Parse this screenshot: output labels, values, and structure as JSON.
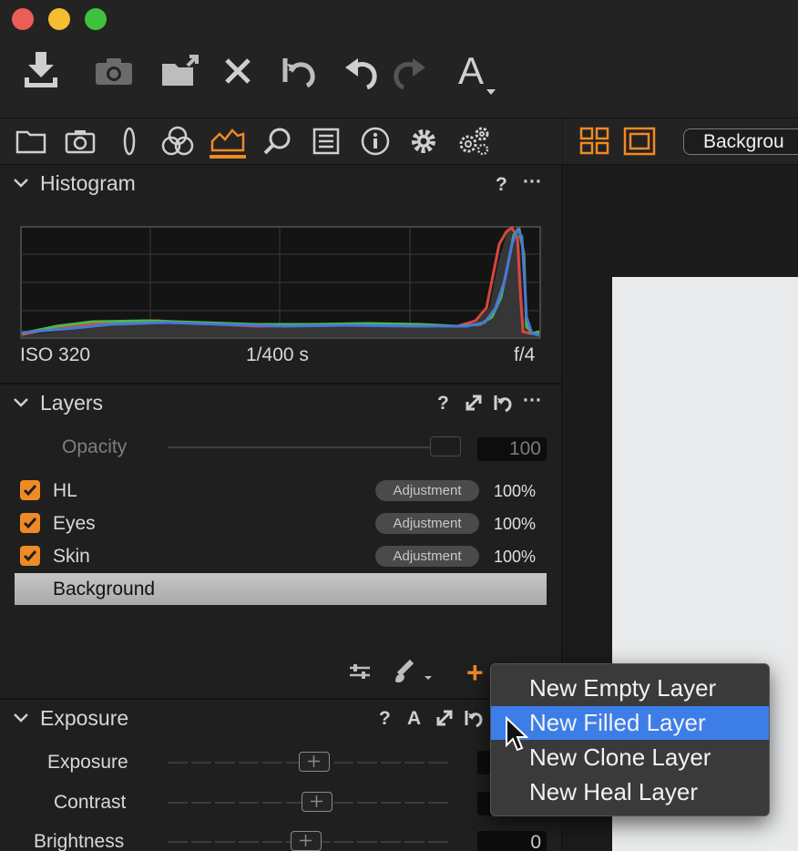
{
  "window": {
    "traffic_lights": {
      "close": "#ed5d57",
      "minimize": "#f5bd30",
      "zoom": "#3fc33d"
    }
  },
  "toolbar": {
    "icons": [
      "import-icon",
      "camera-icon",
      "export-icon",
      "delete-icon",
      "undo-icon",
      "undo-arrow-icon",
      "redo-icon",
      "text-cursor-icon"
    ],
    "text_tool_label": "A"
  },
  "tool_tabs": {
    "icons": [
      "folder-icon",
      "camera-icon",
      "lens-icon",
      "color-icon",
      "exposure-icon",
      "zoom-icon",
      "details-icon",
      "info-icon",
      "gear-icon",
      "gears-icon"
    ],
    "active": "exposure-icon",
    "accent": "#f08a24"
  },
  "viewer": {
    "layout_icons": [
      "grid-view-icon",
      "single-view-icon"
    ],
    "layer_select_value": "Backgrou"
  },
  "histogram": {
    "title": "Histogram",
    "help": "?",
    "more": "···",
    "iso": "ISO 320",
    "shutter": "1/400 s",
    "aperture": "f/4"
  },
  "layers": {
    "title": "Layers",
    "help": "?",
    "more": "···",
    "opacity_label": "Opacity",
    "opacity_value": "100",
    "items": [
      {
        "name": "HL",
        "badge": "Adjustment",
        "opacity": "100%",
        "checked": true
      },
      {
        "name": "Eyes",
        "badge": "Adjustment",
        "opacity": "100%",
        "checked": true
      },
      {
        "name": "Skin",
        "badge": "Adjustment",
        "opacity": "100%",
        "checked": true
      }
    ],
    "background_label": "Background",
    "add_button": "+"
  },
  "context_menu": {
    "items": [
      "New Empty Layer",
      "New Filled Layer",
      "New Clone Layer",
      "New Heal Layer"
    ],
    "selected_index": 1,
    "selected_color": "#3c7de8"
  },
  "exposure": {
    "title": "Exposure",
    "help": "?",
    "auto": "A",
    "sliders": [
      {
        "label": "Exposure",
        "value": "",
        "level": 0.5
      },
      {
        "label": "Contrast",
        "value": "",
        "level": 0.53
      },
      {
        "label": "Brightness",
        "value": "0",
        "level": 0.49
      }
    ]
  }
}
